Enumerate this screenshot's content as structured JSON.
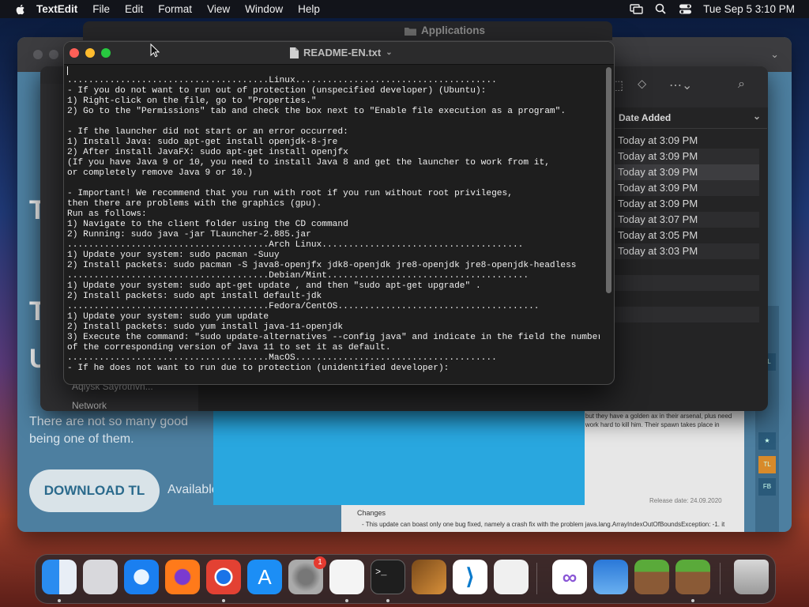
{
  "menubar": {
    "app_name": "TextEdit",
    "items": [
      "File",
      "Edit",
      "Format",
      "View",
      "Window",
      "Help"
    ],
    "datetime": "Tue Sep 5  3:10 PM"
  },
  "applications_window": {
    "title": "Applications"
  },
  "finder": {
    "column_header": "Date Added",
    "dates": [
      "Today at 3:09 PM",
      "Today at 3:09 PM",
      "Today at 3:09 PM",
      "Today at 3:09 PM",
      "Today at 3:09 PM",
      "Today at 3:07 PM",
      "Today at 3:05 PM",
      "Today at 3:03 PM"
    ],
    "selected_index": 2,
    "sidebar_label_1": "Network",
    "sidebar_label_2": "Aqiysk Sayrotnvn..."
  },
  "website": {
    "tagline": "There are not so many good\nbeing one of them.",
    "download_label": "DOWNLOAD TL",
    "available_text": "Available",
    "changes_heading": "Changes",
    "release_date": "Release date: 24.09.2020",
    "article_top": "e, but they have a golden ax in their arsenal, plus need to work hard to kill him. Their spawn takes place in",
    "changelog": "- This update can boast only one bug fixed, namely a crash fix with the problem java.lang.ArrayIndexOutOfBoundsException: -1. it"
  },
  "textedit": {
    "filename": "README-EN.txt",
    "content": "\n......................................Linux......................................\n- If you do not want to run out of protection (unspecified developer) (Ubuntu):\n1) Right-click on the file, go to \"Properties.\"\n2) Go to the \"Permissions\" tab and check the box next to \"Enable file execution as a program\".\n\n- If the launcher did not start or an error occurred:\n1) Install Java: sudo apt-get install openjdk-8-jre\n2) After install JavaFX: sudo apt-get install openjfx\n(If you have Java 9 or 10, you need to install Java 8 and get the launcher to work from it,\nor completely remove Java 9 or 10.)\n\n- Important! We recommend that you run with root if you run without root privileges,\nthen there are problems with the graphics (gpu).\nRun as follows:\n1) Navigate to the client folder using the CD command\n2) Running: sudo java -jar TLauncher-2.885.jar\n......................................Arch Linux......................................\n1) Update your system: sudo pacman -Suuy\n2) Install packets: sudo pacman -S java8-openjfx jdk8-openjdk jre8-openjdk jre8-openjdk-headless\n......................................Debian/Mint......................................\n1) Update your system: sudo apt-get update , and then \"sudo apt-get upgrade\" .\n2) Install packets: sudo apt install default-jdk\n......................................Fedora/CentOS......................................\n1) Update your system: sudo yum update\n2) Install packets: sudo yum install java-11-openjdk\n3) Execute the command: \"sudo update-alternatives --config java\" and indicate in the field the number\nof the corresponding version of Java 11 to set it as default.\n......................................MacOS......................................\n- If he does not want to run due to protection (unidentified developer):"
  },
  "dock": {
    "apps": [
      "finder-icon",
      "launchpad-icon",
      "safari-icon",
      "firefox-icon",
      "chrome-icon",
      "app-store-icon",
      "system-settings-icon",
      "textedit-icon",
      "terminal-icon",
      "garageband-icon",
      "vscode-icon",
      "roblox-icon",
      "visual-studio-icon",
      "weather-icon",
      "minecraft-icon",
      "minecraft-icon-2",
      "trash-icon"
    ],
    "settings_badge": "1"
  }
}
